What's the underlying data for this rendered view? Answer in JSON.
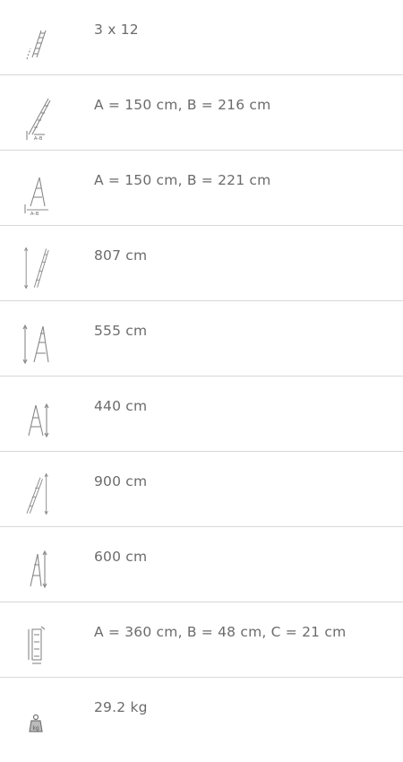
{
  "specs": [
    {
      "icon": "rungs-count-icon",
      "value": "3 x 12"
    },
    {
      "icon": "a-frame-footprint-icon",
      "value": "A = 150 cm, B = 216 cm"
    },
    {
      "icon": "stepladder-footprint-icon",
      "value": "A = 150 cm, B = 221 cm"
    },
    {
      "icon": "max-extension-height-icon",
      "value": "807 cm"
    },
    {
      "icon": "combination-height-icon",
      "value": "555 cm"
    },
    {
      "icon": "a-frame-height-icon",
      "value": "440 cm"
    },
    {
      "icon": "working-height-icon",
      "value": "900 cm"
    },
    {
      "icon": "stepladder-working-height-icon",
      "value": "600 cm"
    },
    {
      "icon": "folded-dimensions-icon",
      "value": "A = 360 cm, B = 48 cm, C = 21 cm"
    },
    {
      "icon": "weight-icon",
      "value": "29.2 kg"
    }
  ]
}
